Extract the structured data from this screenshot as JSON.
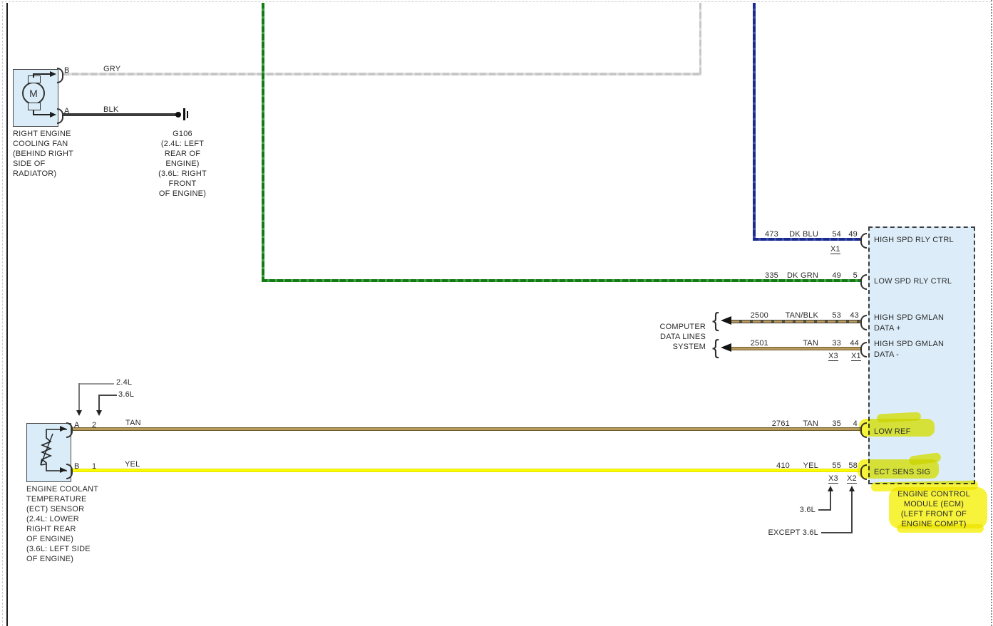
{
  "fan": {
    "motor_letter": "M",
    "pin_top": "B",
    "pin_bottom": "A",
    "wire_top_color": "GRY",
    "wire_bottom_color": "BLK",
    "caption": [
      "RIGHT ENGINE",
      "COOLING FAN",
      "(BEHIND RIGHT",
      "SIDE OF",
      "RADIATOR)"
    ]
  },
  "ground": {
    "caption": [
      "G106",
      "(2.4L: LEFT",
      "REAR OF",
      "ENGINE)",
      "(3.6L: RIGHT",
      "FRONT",
      "OF ENGINE)"
    ]
  },
  "ecm": {
    "rows": {
      "high_spd_rly": {
        "circuit": "473",
        "wire_color": "DK BLU",
        "pin_a": "54",
        "pin_b": "49",
        "connector_a": "X1",
        "label": "HIGH SPD RLY CTRL"
      },
      "low_spd_rly": {
        "circuit": "335",
        "wire_color": "DK GRN",
        "pin_a": "49",
        "pin_b": "5",
        "label": "LOW SPD RLY CTRL"
      },
      "gmlan_plus": {
        "circuit": "2500",
        "wire_color": "TAN/BLK",
        "pin_a": "53",
        "pin_b": "43",
        "label_line1": "HIGH SPD GMLAN",
        "label_line2": "DATA +"
      },
      "gmlan_minus": {
        "circuit": "2501",
        "wire_color": "TAN",
        "pin_a": "33",
        "pin_b": "44",
        "connector_a": "X3",
        "connector_b": "X1",
        "label_line1": "HIGH SPD GMLAN",
        "label_line2": "DATA -"
      },
      "low_ref": {
        "circuit": "2761",
        "wire_color": "TAN",
        "pin_a": "35",
        "pin_b": "4",
        "label": "LOW REF"
      },
      "ect_sens_sig": {
        "circuit": "410",
        "wire_color": "YEL",
        "pin_a": "55",
        "pin_b": "58",
        "connector_a": "X3",
        "connector_b": "X2",
        "label": "ECT SENS SIG"
      }
    },
    "caption": [
      "ENGINE CONTROL",
      "MODULE (ECM)",
      "(LEFT FRONT OF",
      "ENGINE COMPT)"
    ]
  },
  "data_lines": {
    "system_label": [
      "COMPUTER",
      "DATA LINES",
      "SYSTEM"
    ],
    "brace": "{"
  },
  "ect_sensor": {
    "pin_top": "A",
    "pin_top_num": "2",
    "wire_top_color": "TAN",
    "pin_bottom": "B",
    "pin_bottom_num": "1",
    "wire_bottom_color": "YEL",
    "variant_callout_top": "2.4L",
    "variant_callout_bottom": "3.6L",
    "caption": [
      "ENGINE COOLANT",
      "TEMPERATURE",
      "(ECT) SENSOR",
      "(2.4L: LOWER",
      "RIGHT REAR",
      "OF ENGINE)",
      "(3.6L: LEFT SIDE",
      "OF ENGINE)"
    ]
  },
  "bottom_callouts": {
    "v36": "3.6L",
    "except36": "EXCEPT 3.6L"
  },
  "colors": {
    "highlight": "#f7f33a",
    "component_fill": "#d9ecf7",
    "ecm_fill": "#dcedf9",
    "wire_gry": "#c6c6c6",
    "wire_blk": "#3c3c3c",
    "wire_dk_blu": "#1b2b8d",
    "wire_dk_grn": "#147a14",
    "wire_tan": "#b89a5d",
    "wire_yel": "#fdfd05"
  }
}
